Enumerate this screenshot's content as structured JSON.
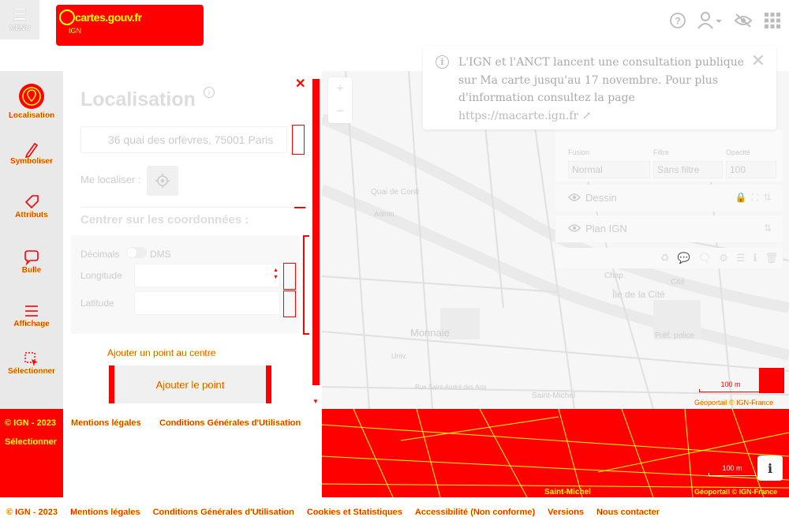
{
  "app": {
    "menu_label": "MENU",
    "logo_name": "cartes.gouv.fr",
    "logo_sub": "IGN"
  },
  "notice": {
    "text": "L'IGN et l'ANCT lancent une consultation publique sur Ma carte jusqu'au 17 novembre. Pour plus d'information consultez la page",
    "link": "https://macarte.ign.fr"
  },
  "rail": [
    {
      "label": "Localisation",
      "icon": "marker-icon"
    },
    {
      "label": "Symboliser",
      "icon": "pencil-icon"
    },
    {
      "label": "Attributs",
      "icon": "tag-icon"
    },
    {
      "label": "Bulle",
      "icon": "speech-bubble-icon"
    },
    {
      "label": "Affichage",
      "icon": "list-icon"
    },
    {
      "label": "Sélectionner",
      "icon": "select-icon"
    }
  ],
  "panel": {
    "title": "Localisation",
    "search_value": "36 quai des orfèvres, 75001 Paris",
    "me_label": "Me localiser :",
    "center_title": "Centrer sur les coordonnées :",
    "decimal_label": "Décimals",
    "dms_label": "DMS",
    "longitude_label": "Longitude",
    "latitude_label": "Latitude",
    "add_hint": "Ajouter un point au centre",
    "add_button": "Ajouter le point"
  },
  "layers": {
    "fusion_label": "Fusion",
    "fusion_value": "Normal",
    "filter_label": "Filtre",
    "filter_value": "Sans filtre",
    "opacity_label": "Opacité",
    "opacity_value": "100",
    "items": [
      {
        "name": "Dessin"
      },
      {
        "name": "Plan IGN"
      }
    ]
  },
  "map": {
    "labels": [
      "Quai de Conti",
      "Monnaie",
      "Île de la Cité",
      "Préf. police",
      "Chap.",
      "Cité",
      "Rue Saint-André des Arts",
      "Saint-Michel",
      "Admin.",
      "Univ."
    ],
    "scale": "100 m",
    "attribution": "Géoportail © IGN-France"
  },
  "strip": {
    "copyright": "© IGN - 2023",
    "mentions": "Mentions légales",
    "cgu": "Conditions Générales d'Utilisation",
    "select_label": "Sélectionner",
    "scale": "100 m",
    "attribution": "Géoportail © IGN-France",
    "map_label": "Saint-Michel"
  },
  "footer": {
    "copyright": "© IGN - 2023",
    "links": [
      "Mentions légales",
      "Conditions Générales d'Utilisation",
      "Cookies et Statistiques",
      "Accessibilité (Non conforme)",
      "Versions",
      "Nous contacter"
    ]
  },
  "colors": {
    "accent": "#ff0000",
    "highlight": "#ffff00",
    "rail_bg": "#e9e9e9"
  }
}
